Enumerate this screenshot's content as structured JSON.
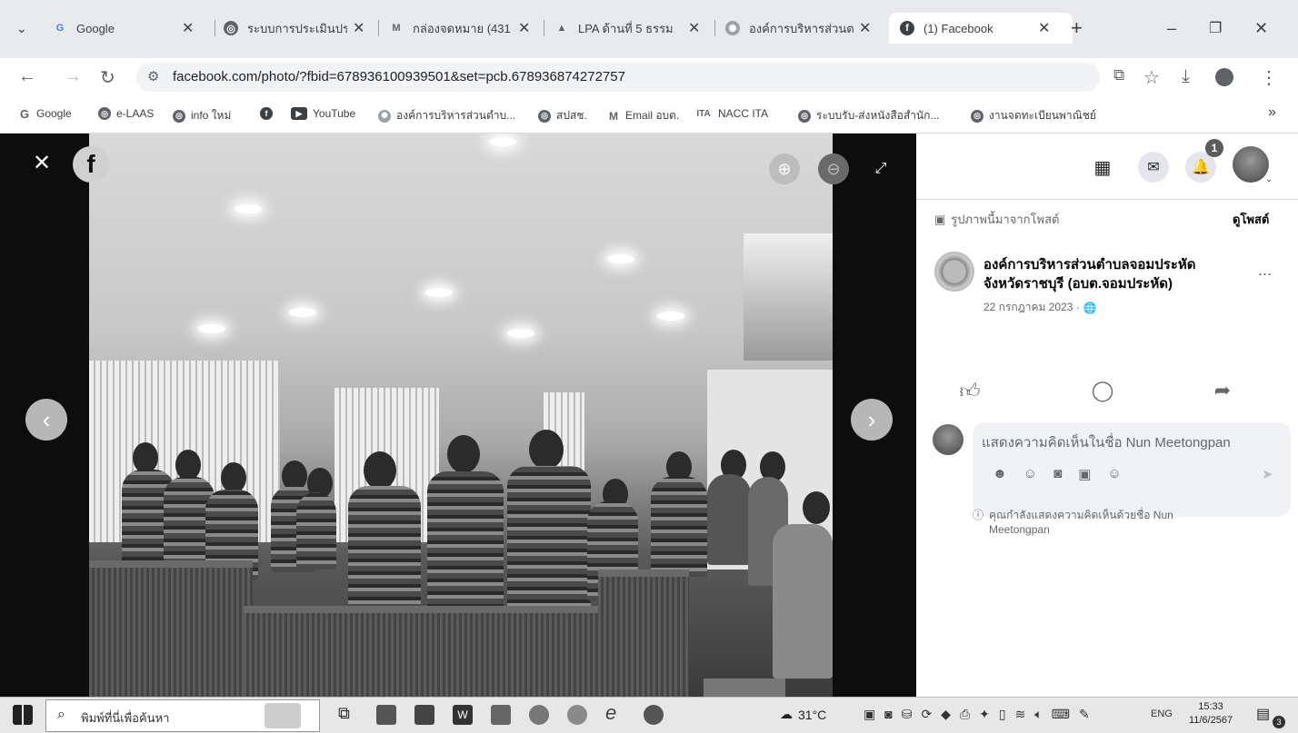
{
  "browser": {
    "tabs": [
      {
        "title": "Google",
        "icon": "google-icon"
      },
      {
        "title": "ระบบการประเมินประ",
        "icon": "web-icon"
      },
      {
        "title": "กล่องจดหมาย (431",
        "icon": "gmail-icon"
      },
      {
        "title": "LPA ด้านที่ 5 ธรรม",
        "icon": "drive-icon"
      },
      {
        "title": "องค์การบริหารส่วนต",
        "icon": "seal-icon"
      },
      {
        "title": "(1) Facebook",
        "icon": "facebook-icon"
      }
    ],
    "new_tab": "+",
    "url": "facebook.com/photo/?fbid=678936100939501&set=pcb.678936874272757",
    "bookmarks": [
      {
        "label": "Google",
        "icon": "google-icon"
      },
      {
        "label": "e-LAAS",
        "icon": "web-icon"
      },
      {
        "label": "info ใหม่",
        "icon": "web-icon"
      },
      {
        "label": "",
        "icon": "facebook-icon"
      },
      {
        "label": "YouTube",
        "icon": "youtube-icon"
      },
      {
        "label": "องค์การบริหารส่วนตำบ...",
        "icon": "seal-icon"
      },
      {
        "label": "สปสช.",
        "icon": "web-icon"
      },
      {
        "label": "Email อบต.",
        "icon": "gmail-icon"
      },
      {
        "label": "NACC ITA",
        "icon": "nacc-icon"
      },
      {
        "label": "ระบบรับ-ส่งหนังสือสำนัก...",
        "icon": "web-icon"
      },
      {
        "label": "งานจดทะเบียนพาณิชย์",
        "icon": "web-icon"
      }
    ],
    "bookmarks_more": "»"
  },
  "viewer": {
    "logo": "f"
  },
  "panel": {
    "notifications_count": "1",
    "album_label": "รูปภาพนี้มาจากโพสต์",
    "view_post": "ดูโพสต์",
    "page_name_line1": "องค์การบริหารส่วนตำบลจอมประหัด",
    "page_name_line2": "จังหวัดราชบุรี (อบต.จอมประหัด)",
    "post_date": "22 กรกฎาคม 2023 ·",
    "more": "...",
    "comment_placeholder": "แสดงความคิดเห็นในชื่อ Nun Meetongpan",
    "comment_notice_line1": "คุณกำลังแสดงความคิดเห็นด้วยชื่อ Nun",
    "comment_notice_line2": "Meetongpan"
  },
  "taskbar": {
    "search_placeholder": "พิมพ์ที่นี่เพื่อค้นหา",
    "weather": "31°C",
    "language": "ENG",
    "time": "15:33",
    "date": "11/6/2567",
    "notification_badge": "3"
  }
}
